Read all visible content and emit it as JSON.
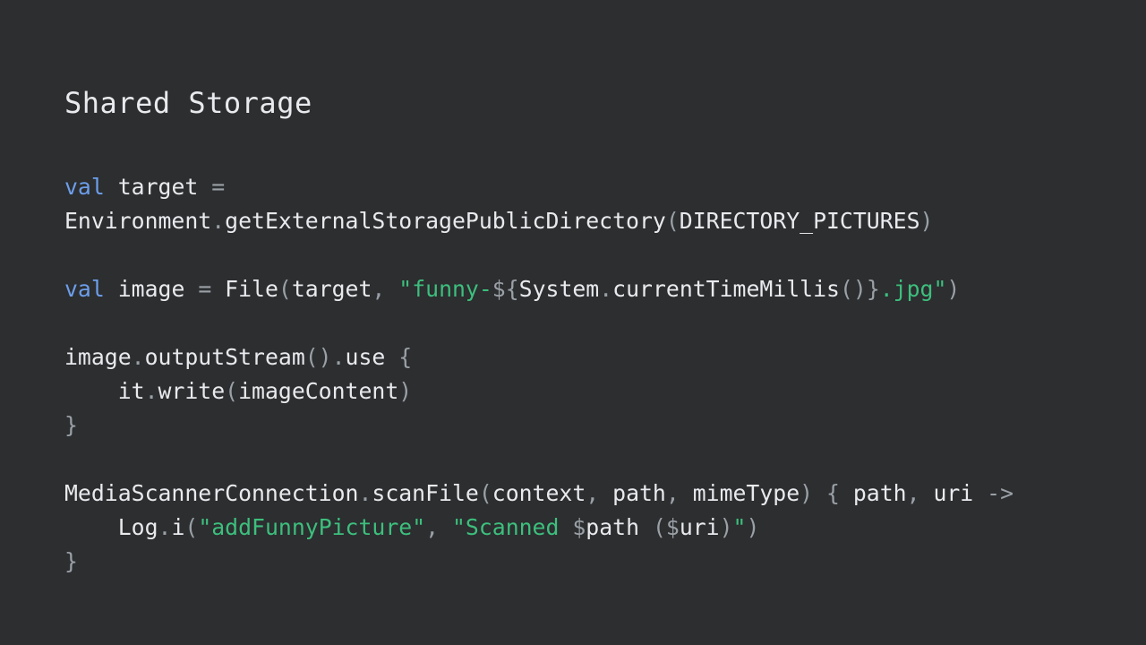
{
  "slide": {
    "title": "Shared Storage",
    "colors": {
      "background": "#2c2e30",
      "text": "#e8eaed",
      "keyword": "#6d9eeb",
      "string": "#3dbf7d",
      "punctuation": "#9aa0a6"
    },
    "code_lines": [
      [
        {
          "t": "kw",
          "v": "val"
        },
        {
          "t": "",
          "v": " target "
        },
        {
          "t": "p",
          "v": "="
        }
      ],
      [
        {
          "t": "",
          "v": "Environment"
        },
        {
          "t": "p",
          "v": "."
        },
        {
          "t": "",
          "v": "getExternalStoragePublicDirectory"
        },
        {
          "t": "p",
          "v": "("
        },
        {
          "t": "",
          "v": "DIRECTORY_PICTURES"
        },
        {
          "t": "p",
          "v": ")"
        }
      ],
      [],
      [
        {
          "t": "kw",
          "v": "val"
        },
        {
          "t": "",
          "v": " image "
        },
        {
          "t": "p",
          "v": "="
        },
        {
          "t": "",
          "v": " File"
        },
        {
          "t": "p",
          "v": "("
        },
        {
          "t": "",
          "v": "target"
        },
        {
          "t": "p",
          "v": ", "
        },
        {
          "t": "str",
          "v": "\"funny-"
        },
        {
          "t": "p",
          "v": "${"
        },
        {
          "t": "",
          "v": "System"
        },
        {
          "t": "p",
          "v": "."
        },
        {
          "t": "",
          "v": "currentTimeMillis"
        },
        {
          "t": "p",
          "v": "()}"
        },
        {
          "t": "str",
          "v": ".jpg\""
        },
        {
          "t": "p",
          "v": ")"
        }
      ],
      [],
      [
        {
          "t": "",
          "v": "image"
        },
        {
          "t": "p",
          "v": "."
        },
        {
          "t": "",
          "v": "outputStream"
        },
        {
          "t": "p",
          "v": "()."
        },
        {
          "t": "",
          "v": "use "
        },
        {
          "t": "p",
          "v": "{"
        }
      ],
      [
        {
          "t": "",
          "v": "    it"
        },
        {
          "t": "p",
          "v": "."
        },
        {
          "t": "",
          "v": "write"
        },
        {
          "t": "p",
          "v": "("
        },
        {
          "t": "",
          "v": "imageContent"
        },
        {
          "t": "p",
          "v": ")"
        }
      ],
      [
        {
          "t": "p",
          "v": "}"
        }
      ],
      [],
      [
        {
          "t": "",
          "v": "MediaScannerConnection"
        },
        {
          "t": "p",
          "v": "."
        },
        {
          "t": "",
          "v": "scanFile"
        },
        {
          "t": "p",
          "v": "("
        },
        {
          "t": "",
          "v": "context"
        },
        {
          "t": "p",
          "v": ", "
        },
        {
          "t": "",
          "v": "path"
        },
        {
          "t": "p",
          "v": ", "
        },
        {
          "t": "",
          "v": "mimeType"
        },
        {
          "t": "p",
          "v": ") { "
        },
        {
          "t": "",
          "v": "path"
        },
        {
          "t": "p",
          "v": ", "
        },
        {
          "t": "",
          "v": "uri "
        },
        {
          "t": "p",
          "v": "->"
        }
      ],
      [
        {
          "t": "",
          "v": "    Log"
        },
        {
          "t": "p",
          "v": "."
        },
        {
          "t": "",
          "v": "i"
        },
        {
          "t": "p",
          "v": "("
        },
        {
          "t": "str",
          "v": "\"addFunnyPicture\""
        },
        {
          "t": "p",
          "v": ", "
        },
        {
          "t": "str",
          "v": "\"Scanned "
        },
        {
          "t": "p",
          "v": "$"
        },
        {
          "t": "",
          "v": "path "
        },
        {
          "t": "p",
          "v": "($"
        },
        {
          "t": "",
          "v": "uri"
        },
        {
          "t": "p",
          "v": ")"
        },
        {
          "t": "str",
          "v": "\""
        },
        {
          "t": "p",
          "v": ")"
        }
      ],
      [
        {
          "t": "p",
          "v": "}"
        }
      ]
    ]
  }
}
